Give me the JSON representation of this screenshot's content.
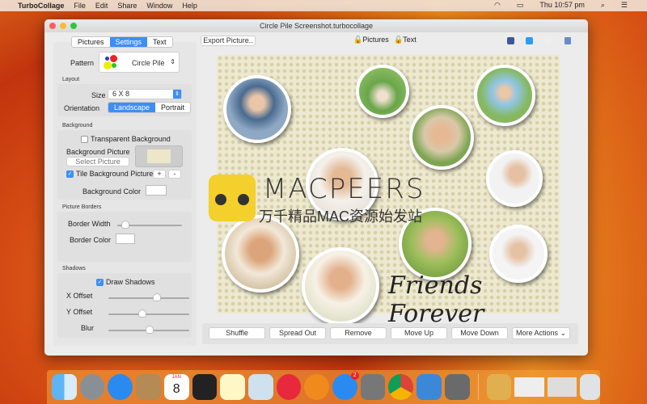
{
  "menubar": {
    "app": "TurboCollage",
    "items": [
      "File",
      "Edit",
      "Share",
      "Window",
      "Help"
    ],
    "clock": "Thu 10:57 pm"
  },
  "window": {
    "title": "Circle Pile Screenshot.turbocollage"
  },
  "tabs": [
    "Pictures",
    "Settings",
    "Text"
  ],
  "active_tab": "Settings",
  "toolbar": {
    "export": "Export Picture..",
    "lock_pictures": "Pictures",
    "lock_text": "Text",
    "share_icons": [
      "facebook-icon",
      "twitter-icon",
      "flickr-icon",
      "share-icon"
    ]
  },
  "settings": {
    "pattern_label": "Pattern",
    "pattern_value": "Circle Pile",
    "layout_title": "Layout",
    "size_label": "Size",
    "size_value": "6 X 8",
    "orientation_label": "Orientation",
    "orientation_options": [
      "Landscape",
      "Portrait"
    ],
    "orientation_value": "Landscape",
    "background_title": "Background",
    "transparent_label": "Transparent Background",
    "transparent_checked": false,
    "bg_picture_label": "Background Picture",
    "select_picture": "Select Picture",
    "tile_label": "Tile Background Picture",
    "tile_checked": true,
    "plus": "+",
    "minus": "-",
    "bg_color_label": "Background Color",
    "borders_title": "Picture Borders",
    "border_width_label": "Border Width",
    "border_width_value": 0.1,
    "border_color_label": "Border Color",
    "shadows_title": "Shadows",
    "draw_shadows_label": "Draw Shadows",
    "draw_shadows_checked": true,
    "x_offset_label": "X Offset",
    "x_offset_value": 0.6,
    "y_offset_label": "Y Offset",
    "y_offset_value": 0.4,
    "blur_label": "Blur",
    "blur_value": 0.5
  },
  "canvas": {
    "caption": "Friends Forever"
  },
  "watermark": {
    "brand": "MACPEERS",
    "tagline": "万千精品MAC资源始发站"
  },
  "actions": [
    "Shuffle",
    "Spread Out",
    "Remove",
    "Move Up",
    "Move Down",
    "More Actions"
  ],
  "dock": {
    "apps": [
      "Finder",
      "Launchpad",
      "Safari",
      "Contacts",
      "Calendar",
      "Terminal",
      "Notes",
      "Preview",
      "iTunes",
      "iBooks",
      "App Store",
      "System Preferences",
      "Chrome",
      "Xcode",
      "Preview Photos",
      "Archive",
      "Window 1",
      "Window 2",
      "Trash"
    ],
    "calendar_day": "8",
    "calendar_month": "JAN",
    "appstore_badge": "2"
  }
}
